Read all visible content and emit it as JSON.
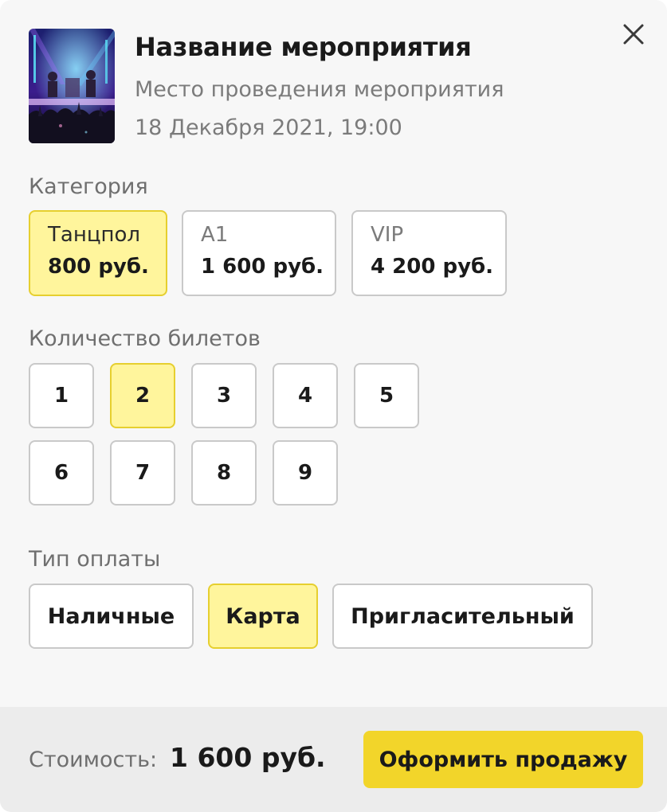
{
  "event": {
    "title": "Название мероприятия",
    "venue": "Место проведения мероприятия",
    "datetime": "18 Декабря 2021, 19:00",
    "image": "concert-photo"
  },
  "close": {
    "icon": "close-icon"
  },
  "category": {
    "label": "Категория",
    "selected": "Танцпол",
    "options": [
      {
        "name": "Танцпол",
        "price": "800 руб."
      },
      {
        "name": "A1",
        "price": "1 600 руб."
      },
      {
        "name": "VIP",
        "price": "4 200 руб."
      }
    ]
  },
  "quantity": {
    "label": "Количество билетов",
    "selected": "2",
    "options": [
      "1",
      "2",
      "3",
      "4",
      "5",
      "6",
      "7",
      "8",
      "9"
    ]
  },
  "payment": {
    "label": "Тип оплаты",
    "selected": "Карта",
    "options": [
      "Наличные",
      "Карта",
      "Пригласительный"
    ]
  },
  "footer": {
    "cost_label": "Стоимость:",
    "cost_value": "1 600 руб.",
    "submit_label": "Оформить продажу"
  },
  "colors": {
    "accent": "#f2d52a",
    "selected_bg": "#fff59c",
    "selected_border": "#e6cf2f",
    "panel_bg": "#f7f7f7",
    "footer_bg": "#ececec"
  }
}
